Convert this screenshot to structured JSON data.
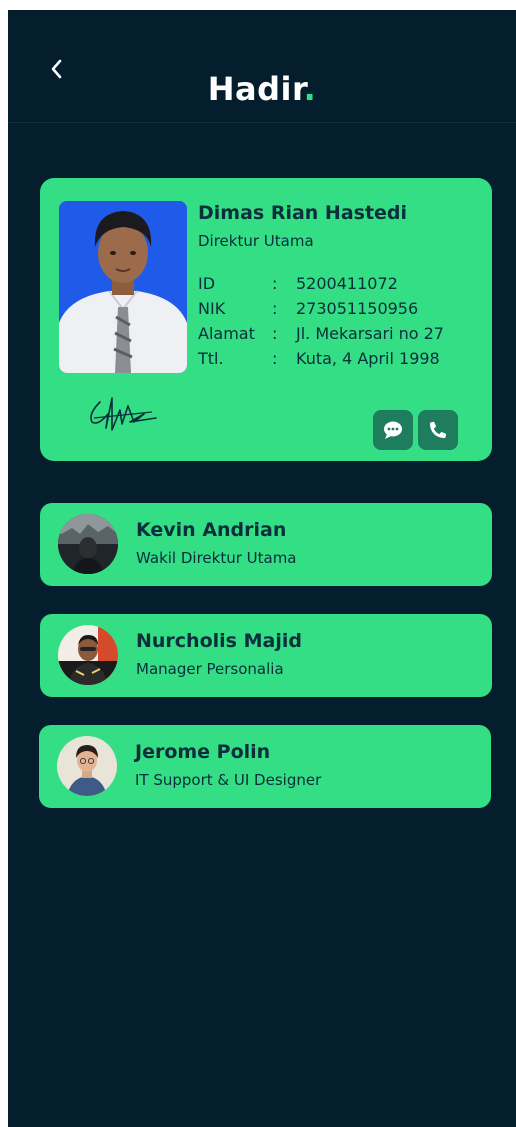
{
  "header": {
    "title": "Hadir",
    "title_dot": "."
  },
  "profile": {
    "name": "Dimas Rian Hastedi",
    "role": "Direktur Utama",
    "fields": [
      {
        "label": "ID",
        "sep": ":",
        "value": "5200411072"
      },
      {
        "label": "NIK",
        "sep": ":",
        "value": "273051150956"
      },
      {
        "label": "Alamat",
        "sep": ":",
        "value": "Jl. Mekarsari no 27"
      },
      {
        "label": "Ttl.",
        "sep": ":",
        "value": "Kuta, 4 April 1998"
      }
    ],
    "actions": [
      "chat-icon",
      "phone-icon"
    ]
  },
  "members": [
    {
      "name": "Kevin Andrian",
      "role": "Wakil Direktur Utama"
    },
    {
      "name": "Nurcholis Majid",
      "role": "Manager Personalia"
    },
    {
      "name": "Jerome Polin",
      "role": "IT Support & UI Designer"
    }
  ],
  "colors": {
    "background": "#041e2d",
    "accent": "#34de84",
    "text_dark": "#0b2e3c",
    "button": "#1e7d5c"
  }
}
